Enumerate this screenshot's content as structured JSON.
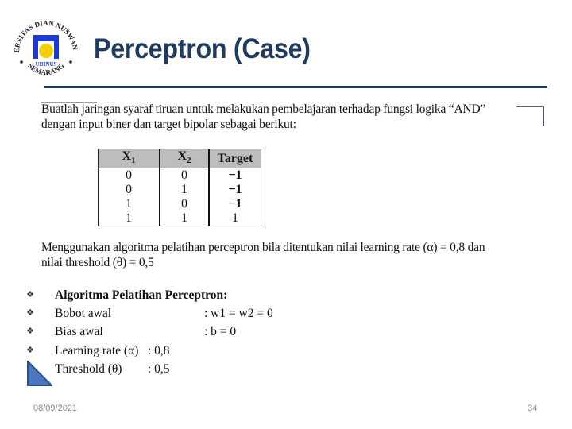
{
  "slide": {
    "title": "Perceptron (Case)",
    "logo": {
      "icon": "udinus-logo-icon",
      "ring_text_top": "UNIVERSITAS DIAN NUSWANTORO",
      "inner_text": "UDINUS",
      "ring_text_bottom": "SEMARANG",
      "colors": {
        "blue": "#1a3bd6",
        "yellow": "#f5d000"
      }
    },
    "intro_line1": "Buatlah jaringan syaraf tiruan untuk melakukan pembelajaran terhadap fungsi logika “AND”",
    "intro_line2": "dengan input biner dan target bipolar sebagai berikut:",
    "table": {
      "headers": [
        {
          "base": "X",
          "sub": "1"
        },
        {
          "base": "X",
          "sub": "2"
        },
        {
          "base": "Target",
          "sub": ""
        }
      ],
      "rows": [
        [
          "0",
          "0",
          "−1"
        ],
        [
          "0",
          "1",
          "−1"
        ],
        [
          "1",
          "0",
          "−1"
        ],
        [
          "1",
          "1",
          "1"
        ]
      ]
    },
    "desc_line1": "Menggunakan algoritma pelatihan perceptron bila ditentukan nilai learning rate (α) = 0,8  dan",
    "desc_line2": "nilai threshold (θ)   = 0,5",
    "bullets": [
      {
        "icon": "diamond-bullet-icon",
        "label": "Algoritma Pelatihan Perceptron:",
        "value": ""
      },
      {
        "icon": "diamond-bullet-icon",
        "label": "Bobot awal",
        "value": ": w1 = w2 = 0"
      },
      {
        "icon": "diamond-bullet-icon",
        "label": "Bias awal",
        "value": ":  b = 0"
      },
      {
        "icon": "diamond-bullet-icon",
        "label": "Learning rate (α)",
        "value": ": 0,8"
      },
      {
        "icon": "diamond-bullet-icon",
        "label": "Threshold (θ)",
        "value": ": 0,5"
      }
    ],
    "accent_color": "#1f3a5f",
    "footer": {
      "date": "08/09/2021",
      "page_number": "34"
    }
  }
}
